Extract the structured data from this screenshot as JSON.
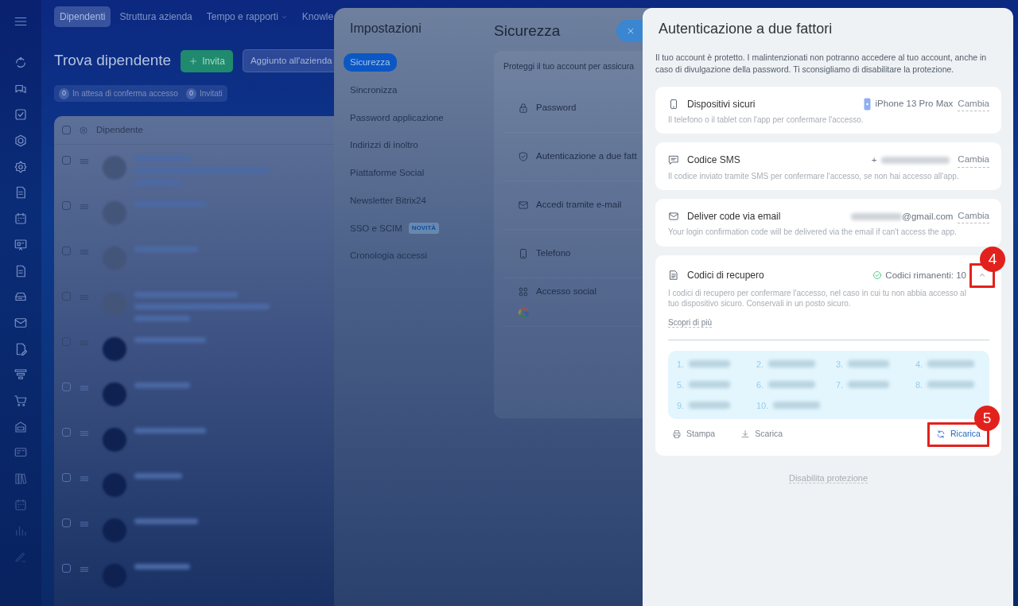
{
  "nav_tabs": [
    {
      "label": "Dipendenti",
      "selected": true
    },
    {
      "label": "Struttura azienda",
      "selected": false
    },
    {
      "label": "Tempo e rapporti",
      "selected": false,
      "dropdown": true
    },
    {
      "label": "Knowle",
      "selected": false
    }
  ],
  "page_title": "Trova dipendente",
  "invite_button": "Invita",
  "added_button": "Aggiunto all'azienda",
  "filters": [
    {
      "count": "0",
      "label": "In attesa di conferma accesso"
    },
    {
      "count": "0",
      "label": "Invitati"
    }
  ],
  "table": {
    "columns": [
      "Dipendente"
    ],
    "header_checked": false,
    "rows": [
      {
        "checked": false
      },
      {
        "checked": false
      },
      {
        "checked": false
      },
      {
        "checked": false
      },
      {
        "checked": false
      },
      {
        "checked": false
      },
      {
        "checked": false
      },
      {
        "checked": false
      },
      {
        "checked": false
      },
      {
        "checked": false
      }
    ]
  },
  "settings": {
    "title": "Impostazioni",
    "menu": [
      {
        "label": "Sicurezza",
        "selected": true
      },
      {
        "label": "Sincronizza",
        "selected": false
      },
      {
        "label": "Password applicazione",
        "selected": false
      },
      {
        "label": "Indirizzi di inoltro",
        "selected": false
      },
      {
        "label": "Piattaforme Social",
        "selected": false
      },
      {
        "label": "Newsletter Bitrix24",
        "selected": false
      },
      {
        "label": "SSO e SCIM",
        "selected": false,
        "badge": "NOVITÀ"
      },
      {
        "label": "Cronologia accessi",
        "selected": false
      }
    ],
    "section_title": "Sicurezza",
    "intro": "Proteggi il tuo account per assicura",
    "options": [
      {
        "kind": "password",
        "label": "Password"
      },
      {
        "kind": "shield",
        "label": "Autenticazione a due fatt"
      },
      {
        "kind": "mail",
        "label": "Accedi tramite e-mail"
      },
      {
        "kind": "phone",
        "label": "Telefono"
      },
      {
        "kind": "social",
        "label": "Accesso social"
      }
    ]
  },
  "two_factor": {
    "title": "Autenticazione a due fattori",
    "description": "Il tuo account è protetto. I malintenzionati non potranno accedere al tuo account, anche in caso di divulgazione della password. Ti sconsigliamo di disabilitare la protezione.",
    "methods": [
      {
        "kind": "device",
        "title": "Dispositivi sicuri",
        "value": "iPhone 13 Pro Max",
        "action": "Cambia",
        "description": "Il telefono o il tablet con l'app per confermare l'accesso."
      },
      {
        "kind": "sms",
        "title": "Codice SMS",
        "value": "+",
        "redacted_after": true,
        "action": "Cambia",
        "description": "Il codice inviato tramite SMS per confermare l'accesso, se non hai accesso all'app."
      },
      {
        "kind": "email",
        "title": "Deliver code via email",
        "value": "@gmail.com",
        "redacted_before": true,
        "action": "Cambia",
        "description": "Your login confirmation code will be delivered via the email if can't access the app."
      }
    ],
    "recovery": {
      "title": "Codici di recupero",
      "status": "Codici rimanenti: 10",
      "expanded": true,
      "description": "I codici di recupero per confermare l'accesso, nel caso in cui tu non abbia accesso al tuo dispositivo sicuro. Conservali in un posto sicuro.",
      "link": "Scopri di più",
      "codes": [
        "1.",
        "2.",
        "3.",
        "4.",
        "5.",
        "6.",
        "7.",
        "8.",
        "9.",
        "10."
      ],
      "actions": [
        {
          "kind": "print",
          "label": "Stampa"
        },
        {
          "kind": "download",
          "label": "Scarica"
        },
        {
          "kind": "reload",
          "label": "Ricarica"
        }
      ]
    },
    "disable_link": "Disabilita protezione"
  },
  "callouts": [
    {
      "number": "4"
    },
    {
      "number": "5"
    }
  ]
}
